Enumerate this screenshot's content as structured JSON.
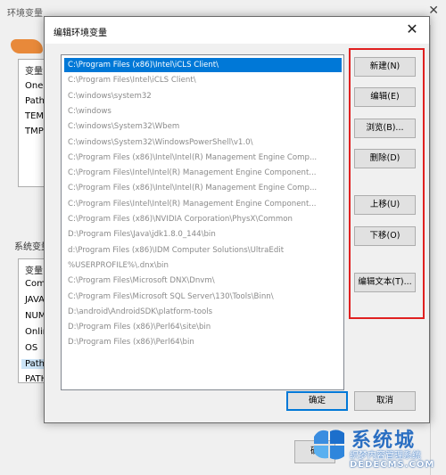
{
  "background_window": {
    "title": "环境变量",
    "close_glyph": "✕",
    "user_vars_header": "变量",
    "user_vars": [
      "OneD",
      "Path",
      "TEMP",
      "TMP"
    ],
    "system_group_label": "系统变量",
    "system_vars_header": "变量",
    "system_vars": [
      "ComS",
      "JAVA",
      "NUM",
      "Onlin",
      "OS",
      "Path",
      "PATH"
    ],
    "bottom_button": "确"
  },
  "dialog": {
    "title": "编辑环境变量",
    "close_glyph": "✕",
    "paths": [
      "C:\\Program Files (x86)\\Intel\\iCLS Client\\",
      "C:\\Program Files\\Intel\\iCLS Client\\",
      "C:\\windows\\system32",
      "C:\\windows",
      "C:\\windows\\System32\\Wbem",
      "C:\\windows\\System32\\WindowsPowerShell\\v1.0\\",
      "C:\\Program Files (x86)\\Intel\\Intel(R) Management Engine Comp...",
      "C:\\Program Files\\Intel\\Intel(R) Management Engine Component...",
      "C:\\Program Files (x86)\\Intel\\Intel(R) Management Engine Comp...",
      "C:\\Program Files\\Intel\\Intel(R) Management Engine Component...",
      "C:\\Program Files (x86)\\NVIDIA Corporation\\PhysX\\Common",
      "D:\\Program Files\\Java\\jdk1.8.0_144\\bin",
      "d:\\Program Files (x86)\\IDM Computer Solutions\\UltraEdit",
      "%USERPROFILE%\\.dnx\\bin",
      "C:\\Program Files\\Microsoft DNX\\Dnvm\\",
      "C:\\Program Files\\Microsoft SQL Server\\130\\Tools\\Binn\\",
      "D:\\android\\AndroidSDK\\platform-tools",
      "D:\\Program Files (x86)\\Perl64\\site\\bin",
      "D:\\Program Files (x86)\\Perl64\\bin"
    ],
    "buttons": {
      "new": "新建(N)",
      "edit": "编辑(E)",
      "browse": "浏览(B)...",
      "delete": "删除(D)",
      "move_up": "上移(U)",
      "move_down": "下移(O)",
      "edit_text": "编辑文本(T)...",
      "ok": "确定",
      "cancel": "取消"
    },
    "highlight_color": "#e02020",
    "selection_color": "#0078d7"
  },
  "watermark": {
    "big_text": "系统城",
    "small_text": "织梦内容管理系统",
    "url": "DEDECMS.COM",
    "brand_color": "#2b6fc2"
  }
}
